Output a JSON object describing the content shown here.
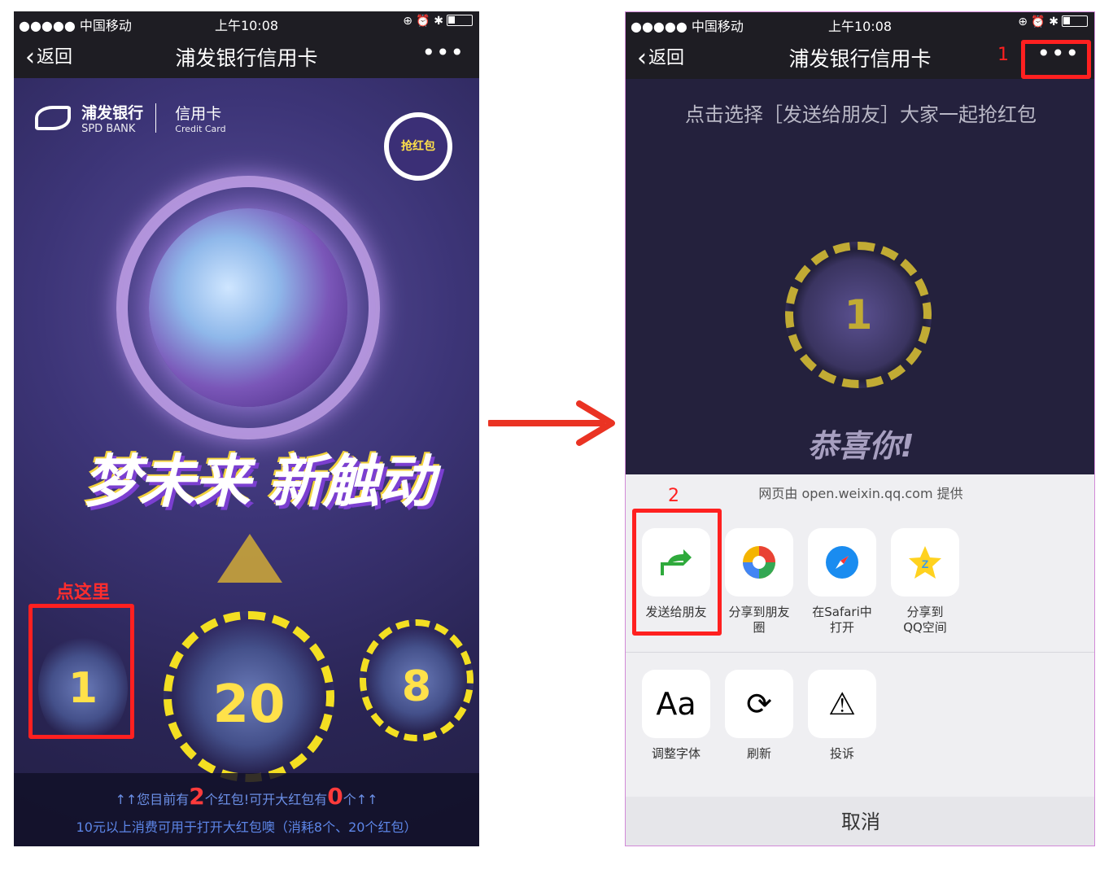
{
  "left": {
    "status": {
      "carrier": "●●●●● 中国移动",
      "time": "上午10:08",
      "icons": "⊕ ⏰ ✱"
    },
    "nav": {
      "back": "返回",
      "title": "浦发银行信用卡",
      "more": "•••"
    },
    "logo": {
      "cn": "浦发银行",
      "en": "SPD BANK",
      "cc": "信用卡",
      "cc_en": "Credit Card"
    },
    "redpacket_badge": "抢红包",
    "slogan": "梦未来 新触动",
    "click_label": "点这里",
    "fingerprints": [
      {
        "value": "1"
      },
      {
        "value": "20"
      },
      {
        "value": "8"
      }
    ],
    "footer": {
      "l1_pre": "↑↑您目前有",
      "count_a": "2",
      "l1_mid": "个红包!可开大红包有",
      "count_b": "0",
      "l1_post": "个↑↑",
      "l2": "10元以上消费可用于打开大红包噢（消耗8个、20个红包）"
    }
  },
  "right": {
    "status": {
      "carrier": "●●●●● 中国移动",
      "time": "上午10:08",
      "icons": "⊕ ⏰ ✱"
    },
    "nav": {
      "back": "返回",
      "title": "浦发银行信用卡",
      "more": "•••"
    },
    "hint": "点击选择［发送给朋友］大家一起抢红包",
    "fingerprint_value": "1",
    "congrats": "恭喜你!",
    "step1": "1",
    "step2": "2",
    "sheet": {
      "provider": "网页由 open.weixin.qq.com 提供",
      "share_items": [
        {
          "label": "发送给朋友",
          "icon": "forward-icon"
        },
        {
          "label": "分享到朋友圈",
          "icon": "moments-icon"
        },
        {
          "label": "在Safari中\n打开",
          "icon": "safari-icon"
        },
        {
          "label": "分享到\nQQ空间",
          "icon": "qzone-icon"
        }
      ],
      "tool_items": [
        {
          "label": "调整字体",
          "icon": "font-icon",
          "glyph": "Aa"
        },
        {
          "label": "刷新",
          "icon": "refresh-icon",
          "glyph": "⟳"
        },
        {
          "label": "投诉",
          "icon": "warning-icon",
          "glyph": "⚠"
        }
      ],
      "cancel": "取消"
    }
  },
  "colors": {
    "annotation_red": "#ff2020",
    "accent_yellow": "#f3df22",
    "nav_bg": "#1e1d23"
  }
}
